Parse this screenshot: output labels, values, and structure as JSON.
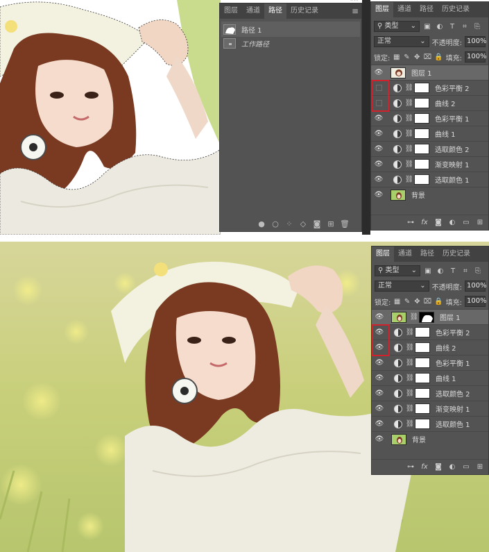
{
  "paths_panel": {
    "tabs": [
      "图层",
      "通道",
      "路径",
      "历史记录"
    ],
    "active_tab": 2,
    "items": [
      {
        "label": "路径 1",
        "italic": false,
        "selected": true
      },
      {
        "label": "工作路径",
        "italic": true,
        "selected": false
      }
    ],
    "bottom_icons": [
      "fill-path-icon",
      "stroke-path-icon",
      "load-selection-icon",
      "make-path-icon",
      "add-mask-icon",
      "new-path-icon",
      "delete-icon"
    ]
  },
  "layers_top": {
    "tabs": [
      "图层",
      "通道",
      "路径",
      "历史记录"
    ],
    "active_tab": 0,
    "filter_label": "类型",
    "blend_mode": "正常",
    "opacity_label": "不透明度:",
    "opacity_value": "100%",
    "lock_label": "锁定:",
    "fill_label": "填充:",
    "fill_value": "100%",
    "layers": [
      {
        "name": "图层 1",
        "kind": "pixel",
        "visible": true,
        "selected": true
      },
      {
        "name": "色彩平衡 2",
        "kind": "adjustment",
        "visible": false
      },
      {
        "name": "曲线 2",
        "kind": "adjustment",
        "visible": false
      },
      {
        "name": "色彩平衡 1",
        "kind": "adjustment",
        "visible": true
      },
      {
        "name": "曲线 1",
        "kind": "adjustment",
        "visible": true
      },
      {
        "name": "选取颜色 2",
        "kind": "adjustment",
        "visible": true
      },
      {
        "name": "渐变映射 1",
        "kind": "adjustment",
        "visible": true
      },
      {
        "name": "选取颜色 1",
        "kind": "adjustment",
        "visible": true
      },
      {
        "name": "背景",
        "kind": "background",
        "visible": true
      }
    ]
  },
  "layers_bottom": {
    "tabs": [
      "图层",
      "通道",
      "路径",
      "历史记录"
    ],
    "active_tab": 0,
    "filter_label": "类型",
    "blend_mode": "正常",
    "opacity_label": "不透明度:",
    "opacity_value": "100%",
    "lock_label": "锁定:",
    "fill_label": "填充:",
    "fill_value": "100%",
    "layers": [
      {
        "name": "图层 1",
        "kind": "pixel-masked",
        "visible": true,
        "selected": true
      },
      {
        "name": "色彩平衡 2",
        "kind": "adjustment",
        "visible": true
      },
      {
        "name": "曲线 2",
        "kind": "adjustment",
        "visible": true
      },
      {
        "name": "色彩平衡 1",
        "kind": "adjustment",
        "visible": true
      },
      {
        "name": "曲线 1",
        "kind": "adjustment",
        "visible": true
      },
      {
        "name": "选取颜色 2",
        "kind": "adjustment",
        "visible": true
      },
      {
        "name": "渐变映射 1",
        "kind": "adjustment",
        "visible": true
      },
      {
        "name": "选取颜色 1",
        "kind": "adjustment",
        "visible": true
      },
      {
        "name": "背景",
        "kind": "background",
        "visible": true
      }
    ]
  },
  "colors": {
    "panel_bg": "#535353",
    "tab_bg": "#424242",
    "highlight_red": "#d0222c",
    "selected_row": "#686868"
  }
}
